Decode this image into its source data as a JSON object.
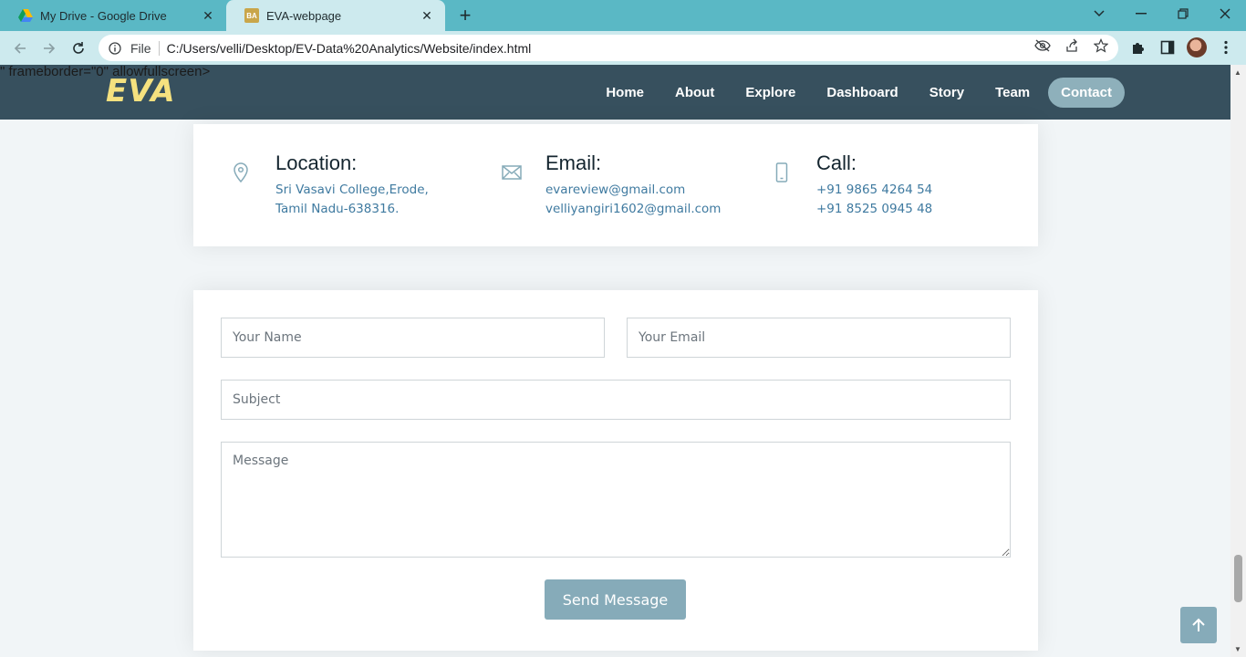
{
  "browser": {
    "tabs": [
      {
        "title": "My Drive - Google Drive",
        "icon": "google-drive-icon",
        "active": false
      },
      {
        "title": "EVA-webpage",
        "icon": "eva-favicon",
        "active": true
      }
    ],
    "favicon_text": "BA",
    "address": {
      "scheme": "File",
      "url": "C:/Users/velli/Desktop/EV-Data%20Analytics/Website/index.html"
    }
  },
  "page": {
    "stray_text": "\" frameborder=\"0\" allowfullscreen>",
    "logo": "EVA",
    "nav": [
      {
        "label": "Home",
        "active": false
      },
      {
        "label": "About",
        "active": false
      },
      {
        "label": "Explore",
        "active": false
      },
      {
        "label": "Dashboard",
        "active": false
      },
      {
        "label": "Story",
        "active": false
      },
      {
        "label": "Team",
        "active": false
      },
      {
        "label": "Contact",
        "active": true
      }
    ],
    "contact_info": {
      "location": {
        "title": "Location:",
        "lines": [
          "Sri Vasavi College,Erode,",
          "Tamil Nadu-638316."
        ]
      },
      "email": {
        "title": "Email:",
        "lines": [
          "evareview@gmail.com",
          "velliyangiri1602@gmail.com"
        ]
      },
      "call": {
        "title": "Call:",
        "lines": [
          "+91 9865 4264 54",
          "+91 8525 0945 48"
        ]
      }
    },
    "form": {
      "name_placeholder": "Your Name",
      "email_placeholder": "Your Email",
      "subject_placeholder": "Subject",
      "message_placeholder": "Message",
      "submit_label": "Send Message"
    }
  },
  "colors": {
    "navbar": "#37505e",
    "logo": "#f5e17f",
    "accent": "#86abb9",
    "link_text": "#3f7aa0",
    "tab_strip": "#5ab8c5"
  }
}
